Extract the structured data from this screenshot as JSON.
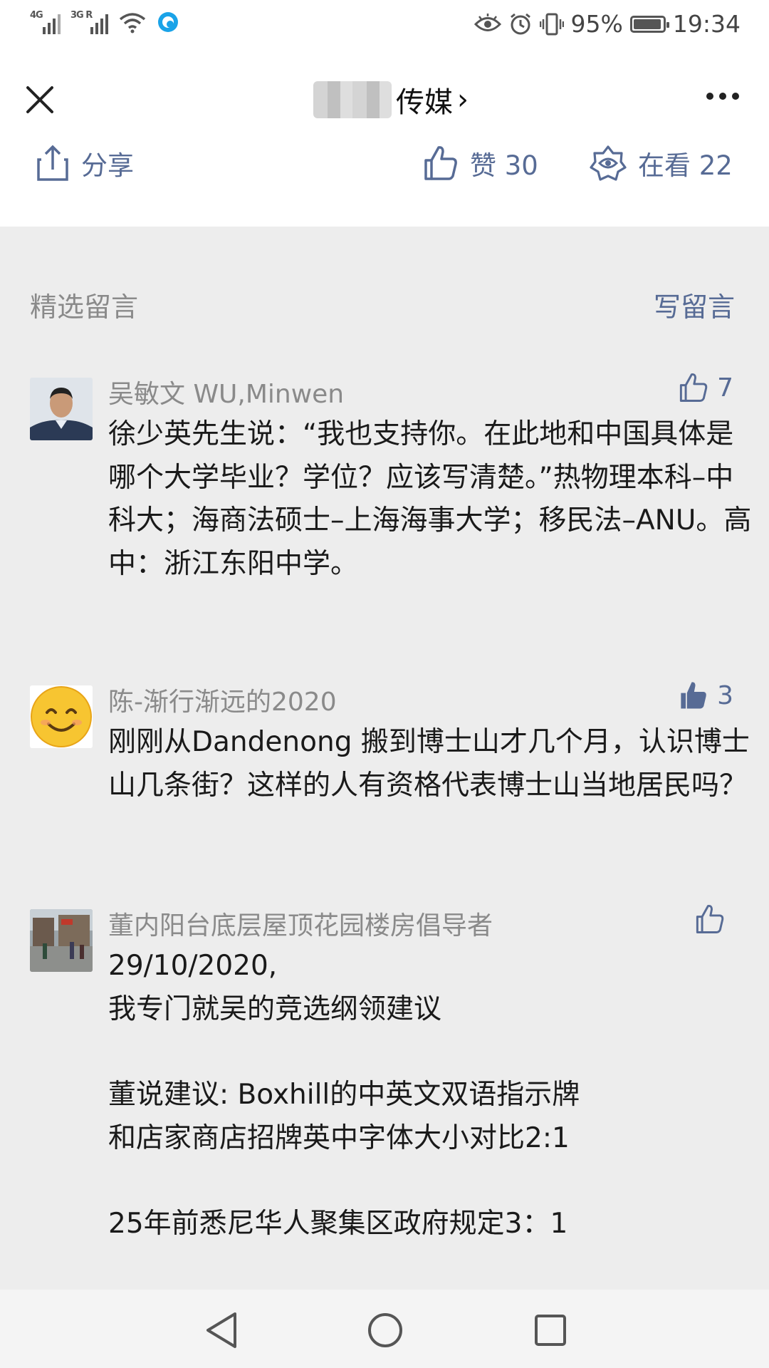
{
  "status_bar": {
    "signal1": "4G",
    "signal2": "3G R",
    "battery_percent": "95%",
    "battery_level": 0.95,
    "time": "19:34"
  },
  "header": {
    "title_suffix": "传媒",
    "chevron": "›"
  },
  "actions": {
    "share_label": "分享",
    "like_label": "赞 30",
    "watch_label": "在看 22"
  },
  "section": {
    "title": "精选留言",
    "write_label": "写留言"
  },
  "comments": [
    {
      "name": "吴敏文 WU,Minwen",
      "likes": "7",
      "liked": false,
      "lines": [
        "徐少英先生说：“我也支持你。在此地和中国具体是哪个大学毕业？学位？应该写清楚。”热物理本科–中科大；海商法硕士–上海海事大学；移民法–ANU。高中：浙江东阳中学。"
      ]
    },
    {
      "name": "陈-渐行渐远的2020",
      "likes": "3",
      "liked": true,
      "lines": [
        "刚刚从Dandenong 搬到博士山才几个月，认识博士山几条街？这样的人有资格代表博士山当地居民吗？"
      ]
    },
    {
      "name": "董内阳台底层屋顶花园楼房倡导者",
      "likes": "",
      "liked": false,
      "lines": [
        "29/10/2020,",
        "我专门就吴的竞选纲领建议",
        "董说建议: Boxhill的中英文双语指示牌",
        "和店家商店招牌英中字体大小对比2:1",
        "25年前悉尼华人聚集区政府规定3：1"
      ]
    }
  ],
  "icons": {
    "close": "close-icon",
    "more": "more-icon",
    "share": "share-icon",
    "like": "thumbs-up-icon",
    "watch": "watching-icon"
  },
  "colors": {
    "link": "#576b95",
    "muted": "#8a8a8a",
    "background": "#ededed"
  }
}
